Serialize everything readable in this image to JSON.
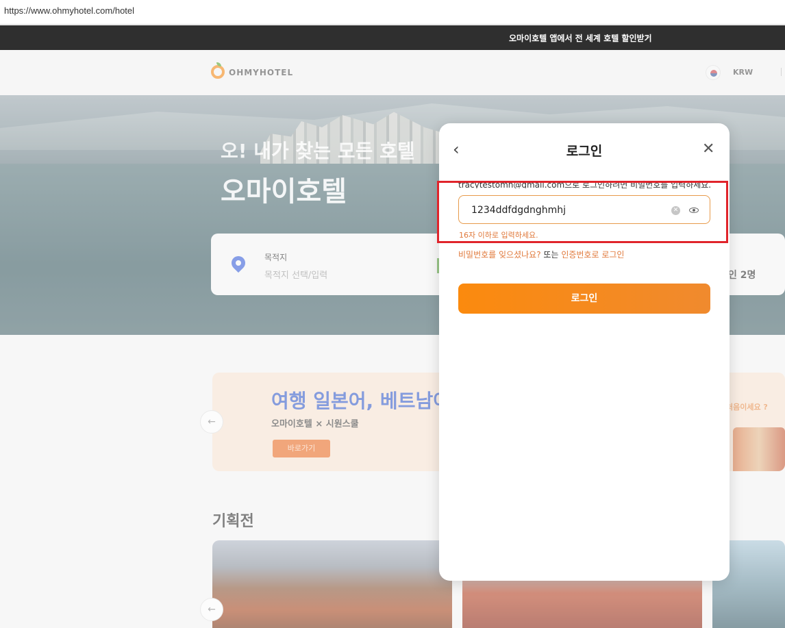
{
  "browser": {
    "url": "https://www.ohmyhotel.com/hotel"
  },
  "promo": {
    "text": "오마이호텔 앱에서 전 세계 호텔 할인받기",
    "chevron": "⌵"
  },
  "header": {
    "logo_text": "OHMYHOTEL",
    "currency": "KRW",
    "flag_icon": "korea-flag-icon"
  },
  "hero": {
    "slogan1": "오! 내가 찾는 모든 호텔",
    "slogan2": "오마이호텔",
    "search": {
      "destination_label": "목적지",
      "destination_placeholder": "목적지 선택/입력",
      "guests": "인 2명"
    }
  },
  "banner": {
    "title": "여행 일본어, 베트남어",
    "subtitle": "오마이호텔 × 시원스쿨",
    "button": "바로가기",
    "right_tag": "처음이세요 ?"
  },
  "section": {
    "title": "기획전"
  },
  "modal": {
    "title": "로그인",
    "back_icon": "‹",
    "close_icon": "✕",
    "helper": "tracytestomh@gmail.com으로 로그인하려면 비밀번호를 입력하세요.",
    "password_value": "1234ddfdgdnghmhj",
    "error": "16자 이하로 입력하세요.",
    "forgot_link": "비밀번호를 잊으셨나요?",
    "or_text": " 또는 ",
    "code_link": "인증번호로 로그인",
    "login_button": "로그인"
  },
  "colors": {
    "accent": "#f28c1c",
    "error": "#e0783a",
    "highlight": "#e0242b",
    "promo_bg": "#2f2f2f"
  }
}
